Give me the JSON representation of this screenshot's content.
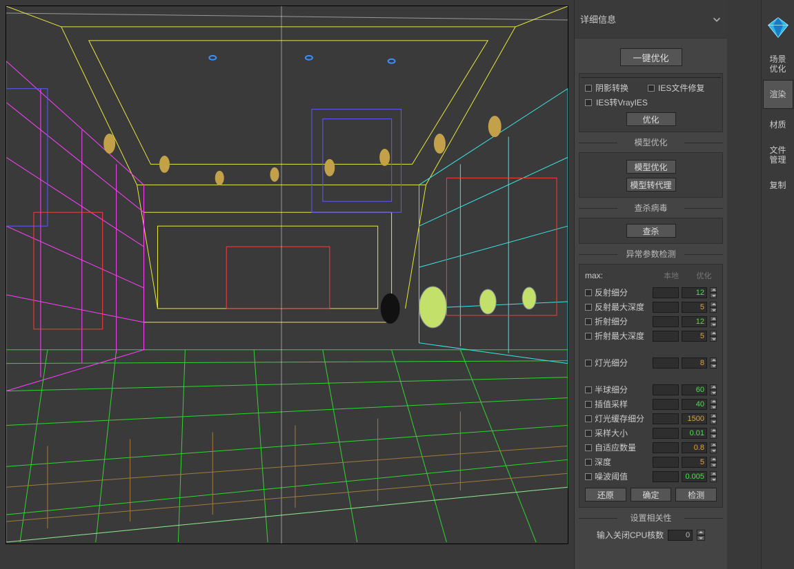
{
  "panel": {
    "header": "详细信息",
    "one_click_optimize": "一键优化",
    "shadow_convert": "阴影转换",
    "ies_fix": "IES文件修复",
    "ies_to_vray": "IES转VrayIES",
    "optimize_btn": "优化",
    "model_opt_title": "模型优化",
    "model_opt_btn": "模型优化",
    "model_proxy_btn": "模型转代理",
    "kill_virus_title": "查杀病毒",
    "kill_btn": "查杀",
    "abnormal_title": "异常参数检测",
    "max_label": "max:",
    "col_local": "本地",
    "col_opt": "优化",
    "params": [
      {
        "label": "反射细分",
        "local": "",
        "opt": "12",
        "cls": "green"
      },
      {
        "label": "反射最大深度",
        "local": "",
        "opt": "5",
        "cls": "orange"
      },
      {
        "label": "折射细分",
        "local": "",
        "opt": "12",
        "cls": "green"
      },
      {
        "label": "折射最大深度",
        "local": "",
        "opt": "5",
        "cls": "orange"
      },
      {
        "label": "灯光细分",
        "local": "",
        "opt": "8",
        "cls": "orange",
        "gap": true
      },
      {
        "label": "半球细分",
        "local": "",
        "opt": "60",
        "cls": "green",
        "gap": true
      },
      {
        "label": "插值采样",
        "local": "",
        "opt": "40",
        "cls": "green"
      },
      {
        "label": "灯光缓存细分",
        "local": "",
        "opt": "1500",
        "cls": "orange"
      },
      {
        "label": "采样大小",
        "local": "",
        "opt": "0.01",
        "cls": "green"
      },
      {
        "label": "自适应数量",
        "local": "",
        "opt": "0.8",
        "cls": "orange"
      },
      {
        "label": "深度",
        "local": "",
        "opt": "5",
        "cls": "orange"
      },
      {
        "label": "噪波阈值",
        "local": "",
        "opt": "0.005",
        "cls": "green"
      }
    ],
    "restore_btn": "还原",
    "confirm_btn": "确定",
    "detect_btn": "检测",
    "relevance_title": "设置相关性",
    "cpu_label": "输入关闭CPU核数",
    "cpu_value": "0"
  },
  "tools": {
    "items": [
      {
        "key": "scene-opt",
        "label": "场景\n优化",
        "active": false
      },
      {
        "key": "render",
        "label": "渲染",
        "active": true
      },
      {
        "key": "material",
        "label": "材质",
        "active": false
      },
      {
        "key": "file-mgr",
        "label": "文件\n管理",
        "active": false
      },
      {
        "key": "copy",
        "label": "复制",
        "active": false
      }
    ]
  },
  "viewport": {
    "description": "3D wireframe perspective view of interior showroom scene"
  }
}
